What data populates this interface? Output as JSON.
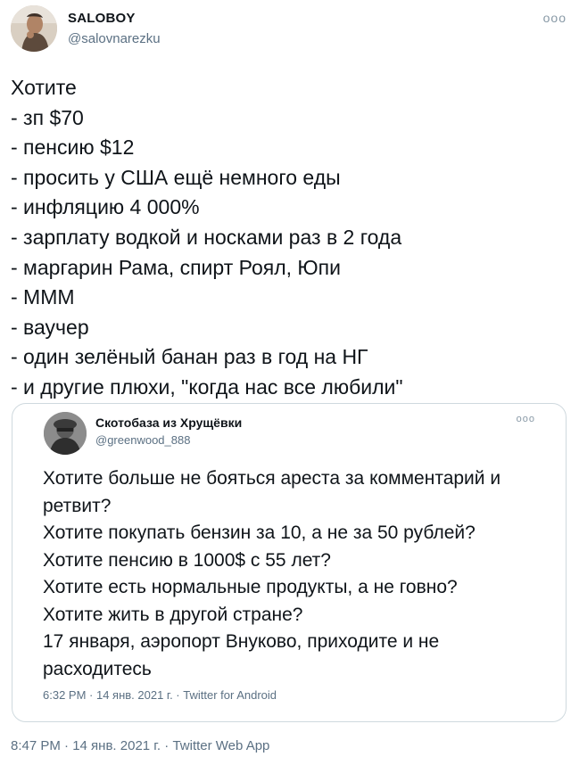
{
  "author": {
    "name": "SALOBOY",
    "handle": "@salovnarezku"
  },
  "more_icon": "more-horizontal-icon",
  "tweet_lines": [
    "Хотите",
    "- зп $70",
    "- пенсию $12",
    "- просить у США ещё немного еды",
    "- инфляцию 4 000%",
    "- зарплату водкой и носками раз в 2 года",
    "- маргарин Рама, спирт Роял, Юпи",
    "- МММ",
    "- ваучер",
    "- один зелёный банан раз в год на НГ",
    "- и другие плюхи, \"когда нас все любили\""
  ],
  "quoted": {
    "name": "Скотобаза из Хрущёвки",
    "handle": "@greenwood_888",
    "lines": [
      "Хотите больше не бояться ареста за комментарий и",
      "ретвит?",
      "Хотите покупать бензин за 10, а не за 50 рублей?",
      "Хотите пенсию в 1000$ с 55 лет?",
      "Хотите есть нормальные продукты, а не говно?",
      "Хотите жить в другой стране?",
      "17 января, аэропорт Внуково, приходите и не",
      "расходитесь"
    ],
    "meta": "6:32 PM · 14 янв. 2021 г. · Twitter for Android"
  },
  "meta": {
    "time": "8:47 PM · 14 янв. 2021 г. · ",
    "source": "Twitter Web App"
  }
}
